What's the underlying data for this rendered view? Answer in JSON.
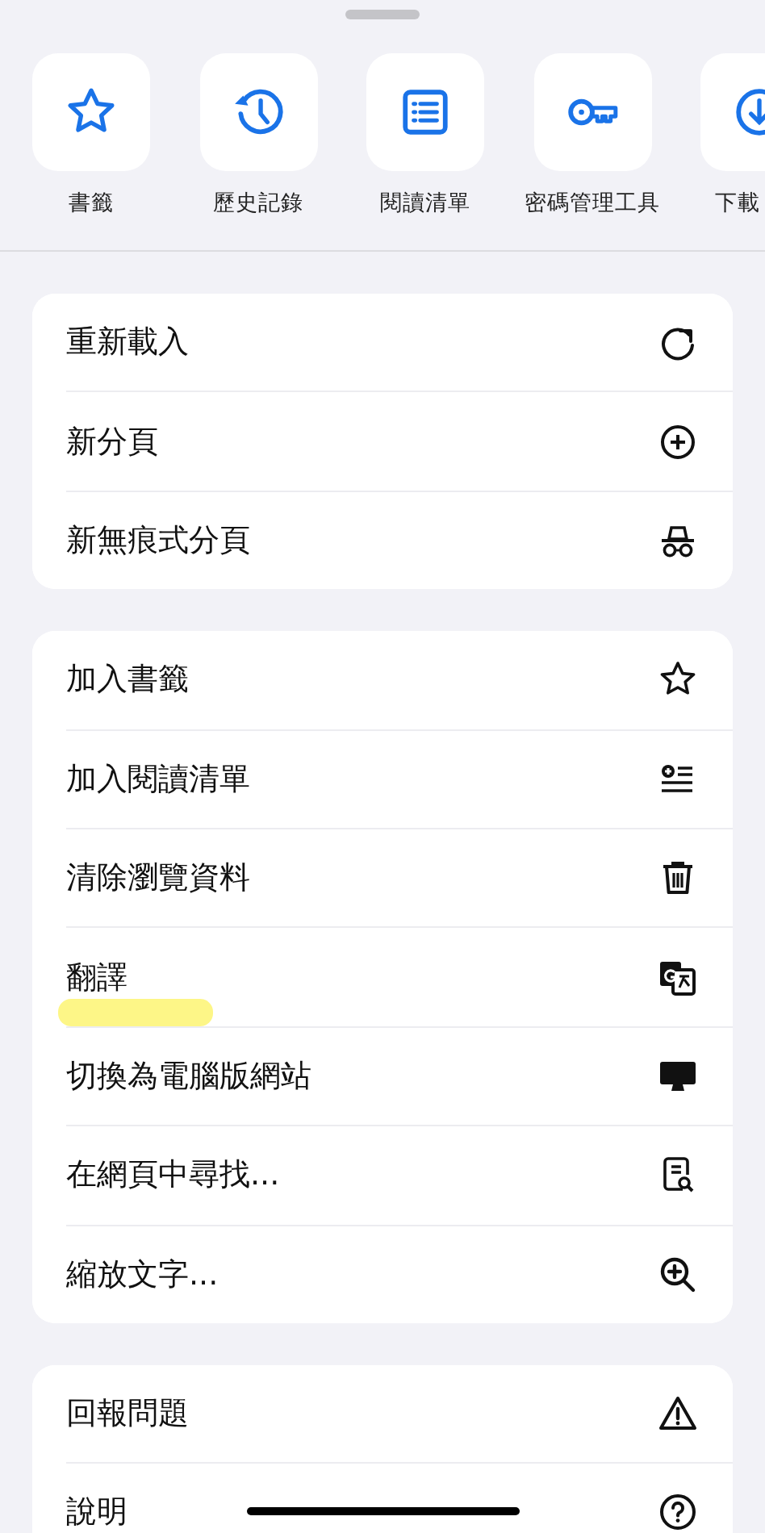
{
  "shortcuts": [
    {
      "label": "書籤"
    },
    {
      "label": "歷史記錄"
    },
    {
      "label": "閱讀清單"
    },
    {
      "label": "密碼管理工具"
    },
    {
      "label": "下載"
    }
  ],
  "groups": [
    {
      "items": [
        {
          "label": "重新載入",
          "highlighted": false
        },
        {
          "label": "新分頁",
          "highlighted": false
        },
        {
          "label": "新無痕式分頁",
          "highlighted": false
        }
      ]
    },
    {
      "items": [
        {
          "label": "加入書籤",
          "highlighted": false
        },
        {
          "label": "加入閱讀清單",
          "highlighted": false
        },
        {
          "label": "清除瀏覽資料",
          "highlighted": false
        },
        {
          "label": "翻譯",
          "highlighted": true
        },
        {
          "label": "切換為電腦版網站",
          "highlighted": false
        },
        {
          "label": "在網頁中尋找...",
          "highlighted": false
        },
        {
          "label": "縮放文字...",
          "highlighted": false
        }
      ]
    },
    {
      "items": [
        {
          "label": "回報問題",
          "highlighted": false
        },
        {
          "label": "說明",
          "highlighted": false
        }
      ]
    }
  ]
}
